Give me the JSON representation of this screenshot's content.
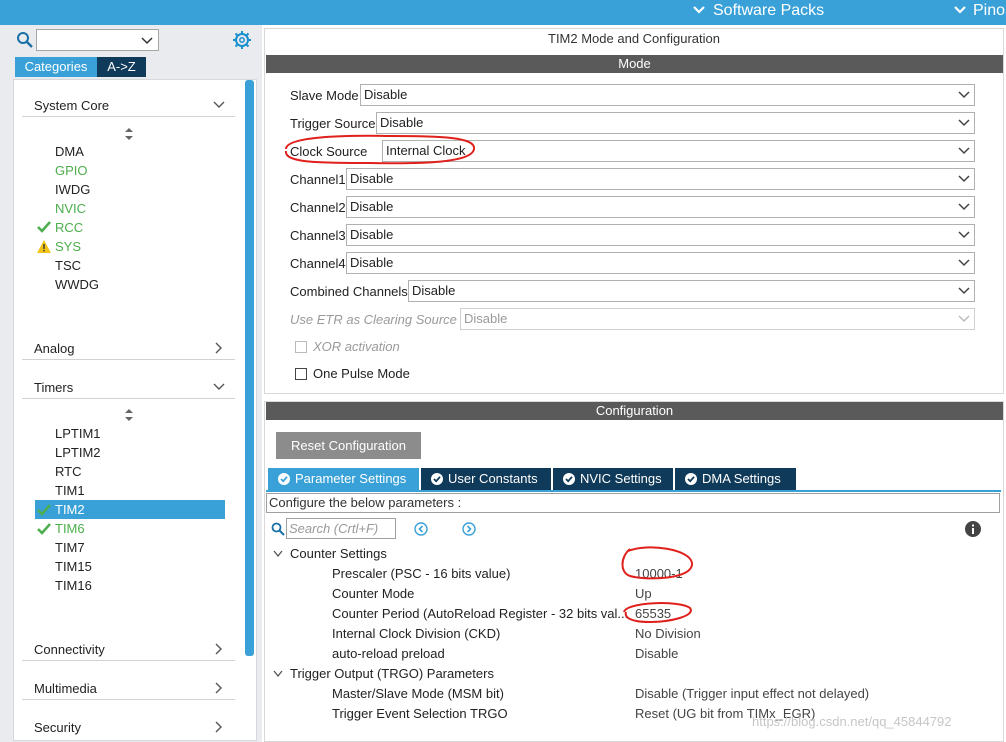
{
  "topbar": {
    "software_packs": "Software Packs",
    "pinout": "Pino"
  },
  "left": {
    "tab_categories": "Categories",
    "tab_az": "A->Z",
    "sections": {
      "system_core": "System Core",
      "analog": "Analog",
      "timers": "Timers",
      "connectivity": "Connectivity",
      "multimedia": "Multimedia",
      "security": "Security"
    },
    "system_core_items": [
      "DMA",
      "GPIO",
      "IWDG",
      "NVIC",
      "RCC",
      "SYS",
      "TSC",
      "WWDG"
    ],
    "timer_items": [
      "LPTIM1",
      "LPTIM2",
      "RTC",
      "TIM1",
      "TIM2",
      "TIM6",
      "TIM7",
      "TIM15",
      "TIM16"
    ]
  },
  "mode": {
    "title": "TIM2 Mode and Configuration",
    "header": "Mode",
    "rows": {
      "slave_mode": {
        "label": "Slave Mode",
        "value": "Disable"
      },
      "trigger_source": {
        "label": "Trigger Source",
        "value": "Disable"
      },
      "clock_source": {
        "label": "Clock Source",
        "value": "Internal Clock"
      },
      "channel1": {
        "label": "Channel1",
        "value": "Disable"
      },
      "channel2": {
        "label": "Channel2",
        "value": "Disable"
      },
      "channel3": {
        "label": "Channel3",
        "value": "Disable"
      },
      "channel4": {
        "label": "Channel4",
        "value": "Disable"
      },
      "combined": {
        "label": "Combined Channels",
        "value": "Disable"
      },
      "etr": {
        "label": "Use ETR as Clearing Source",
        "value": "Disable"
      }
    },
    "xor_label": "XOR activation",
    "one_pulse_label": "One Pulse Mode"
  },
  "config": {
    "header": "Configuration",
    "reset_label": "Reset Configuration",
    "tabs": [
      "Parameter Settings",
      "User Constants",
      "NVIC Settings",
      "DMA Settings"
    ],
    "configure_text": "Configure the below parameters :",
    "search_placeholder": "Search (Crtl+F)",
    "groups": {
      "counter": "Counter Settings",
      "trgo": "Trigger Output (TRGO) Parameters"
    },
    "params": {
      "prescaler": {
        "label": "Prescaler (PSC - 16 bits value)",
        "value": "10000-1"
      },
      "counter_mode": {
        "label": "Counter Mode",
        "value": "Up"
      },
      "counter_period": {
        "label": "Counter Period (AutoReload Register - 32 bits val...",
        "value": "65535"
      },
      "ckd": {
        "label": "Internal Clock Division (CKD)",
        "value": "No Division"
      },
      "autoreload": {
        "label": "auto-reload preload",
        "value": "Disable"
      },
      "msm": {
        "label": "Master/Slave Mode (MSM bit)",
        "value": "Disable (Trigger input effect not delayed)"
      },
      "trgo_sel": {
        "label": "Trigger Event Selection TRGO",
        "value": "Reset (UG bit from TIMx_EGR)"
      }
    }
  },
  "watermark": "https://blog.csdn.net/qq_45844792",
  "colors": {
    "accent": "#39a1d8",
    "dark_tab": "#103a5a",
    "ok_green": "#4cae4c",
    "warn_yellow": "#f0c419",
    "annotation_red": "#e0201c"
  }
}
